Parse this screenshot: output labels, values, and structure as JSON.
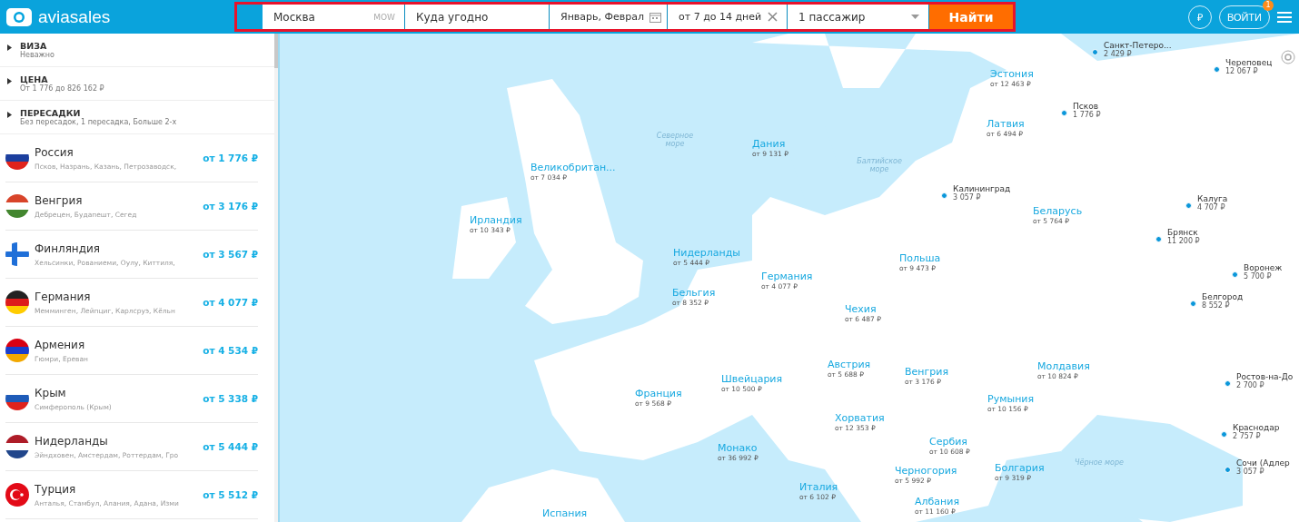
{
  "header": {
    "logo": "aviasales",
    "search": {
      "origin": "Москва",
      "origin_code": "MOW",
      "destination_placeholder": "Куда угодно",
      "dates": "Январь, Феврал",
      "duration": "от 7 до 14 дней",
      "passengers": "1 пассажир",
      "submit": "Найти"
    },
    "currency": "₽",
    "login": "ВОЙТИ",
    "notification_count": "1"
  },
  "filters": [
    {
      "title": "ВИЗА",
      "value": "Неважно",
      "expanded": false
    },
    {
      "title": "ЦЕНА",
      "value": "От 1 776 до 826 162 ₽",
      "expanded": false
    },
    {
      "title": "ПЕРЕСАДКИ",
      "value": "Без пересадок, 1 пересадка, Больше 2-х",
      "expanded": false
    }
  ],
  "destinations": [
    {
      "country": "Россия",
      "cities": "Псков, Назрань, Казань, Петрозаводск,",
      "price": "от 1 776 ₽"
    },
    {
      "country": "Венгрия",
      "cities": "Дебрецен, Будапешт, Сегед",
      "price": "от 3 176 ₽"
    },
    {
      "country": "Финляндия",
      "cities": "Хельсинки, Рованиеми, Оулу, Киттиля,",
      "price": "от 3 567 ₽"
    },
    {
      "country": "Германия",
      "cities": "Мемминген, Лейпциг, Карлсруэ, Кёльн",
      "price": "от 4 077 ₽"
    },
    {
      "country": "Армения",
      "cities": "Гюмри, Ереван",
      "price": "от 4 534 ₽"
    },
    {
      "country": "Крым",
      "cities": "Симферополь (Крым)",
      "price": "от 5 338 ₽"
    },
    {
      "country": "Нидерланды",
      "cities": "Эйндховен, Амстердам, Роттердам, Гро",
      "price": "от 5 444 ₽"
    },
    {
      "country": "Турция",
      "cities": "Анталья, Стамбул, Алания, Адана, Изми",
      "price": "от 5 512 ₽"
    }
  ],
  "map": {
    "seas": [
      "Северное море",
      "Балтийское море",
      "Чёрное море"
    ],
    "countries": [
      {
        "name": "Эстония",
        "price": "от 12 463 ₽"
      },
      {
        "name": "Латвия",
        "price": "от 6 494 ₽"
      },
      {
        "name": "Дания",
        "price": "от 9 131 ₽"
      },
      {
        "name": "Великобритан...",
        "price": "от 7 034 ₽"
      },
      {
        "name": "Беларусь",
        "price": "от 5 764 ₽"
      },
      {
        "name": "Ирландия",
        "price": "от 10 343 ₽"
      },
      {
        "name": "Нидерланды",
        "price": "от 5 444 ₽"
      },
      {
        "name": "Польша",
        "price": "от 9 473 ₽"
      },
      {
        "name": "Германия",
        "price": "от 4 077 ₽"
      },
      {
        "name": "Бельгия",
        "price": "от 8 352 ₽"
      },
      {
        "name": "Чехия",
        "price": "от 6 487 ₽"
      },
      {
        "name": "Австрия",
        "price": "от 5 688 ₽"
      },
      {
        "name": "Молдавия",
        "price": "от 10 824 ₽"
      },
      {
        "name": "Венгрия",
        "price": "от 3 176 ₽"
      },
      {
        "name": "Швейцария",
        "price": "от 10 500 ₽"
      },
      {
        "name": "Франция",
        "price": "от 9 568 ₽"
      },
      {
        "name": "Румыния",
        "price": "от 10 156 ₽"
      },
      {
        "name": "Хорватия",
        "price": "от 12 353 ₽"
      },
      {
        "name": "Сербия",
        "price": "от 10 608 ₽"
      },
      {
        "name": "Монако",
        "price": "от 36 992 ₽"
      },
      {
        "name": "Черногория",
        "price": "от 5 992 ₽"
      },
      {
        "name": "Болгария",
        "price": "от 9 319 ₽"
      },
      {
        "name": "Италия",
        "price": "от 6 102 ₽"
      },
      {
        "name": "Албания",
        "price": "от 11 160 ₽"
      }
    ],
    "edge_label": "Испания",
    "cities": [
      {
        "name": "Санкт-Петеро...",
        "price": "2 429 ₽"
      },
      {
        "name": "Череповец",
        "price": "12 067 ₽"
      },
      {
        "name": "Псков",
        "price": "1 776 ₽"
      },
      {
        "name": "Калининград",
        "price": "3 057 ₽"
      },
      {
        "name": "Калуга",
        "price": "4 707 ₽"
      },
      {
        "name": "Брянск",
        "price": "11 200 ₽"
      },
      {
        "name": "Воронеж",
        "price": "5 700 ₽"
      },
      {
        "name": "Белгород",
        "price": "8 552 ₽"
      },
      {
        "name": "Ростов-на-До",
        "price": "2 700 ₽"
      },
      {
        "name": "Краснодар",
        "price": "2 757 ₽"
      },
      {
        "name": "Сочи (Адлер",
        "price": "3 057 ₽"
      }
    ]
  }
}
